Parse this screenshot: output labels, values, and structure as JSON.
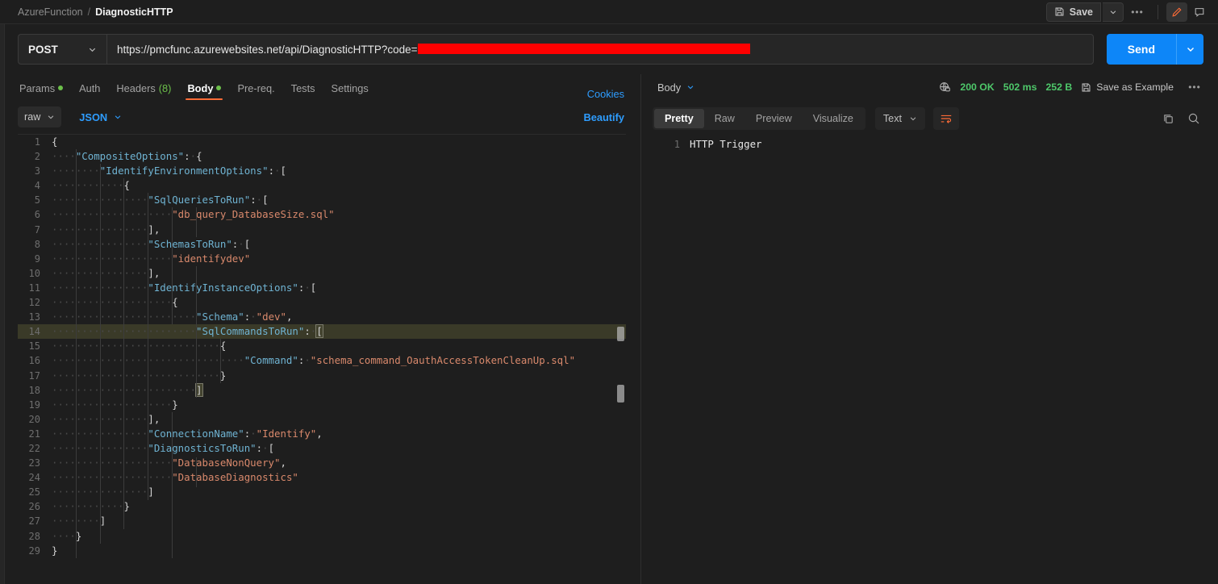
{
  "breadcrumb": {
    "collection": "AzureFunction",
    "separator": "/",
    "request": "DiagnosticHTTP"
  },
  "topbar": {
    "save_label": "Save",
    "save_icon": "floppy-disk-icon",
    "caret_icon": "chevron-down-icon",
    "more_icon": "ellipsis-icon",
    "edit_icon": "pencil-icon",
    "comment_icon": "comment-icon",
    "accent": "#ff6c37"
  },
  "request": {
    "method": "POST",
    "method_caret": "chevron-down-icon",
    "url_visible": "https://pmcfunc.azurewebsites.net/api/DiagnosticHTTP?code=",
    "url_redacted_note": "redacted-secret-bar",
    "redaction_color": "#fe0000",
    "send_label": "Send",
    "send_color": "#0d86f8"
  },
  "request_tabs": [
    {
      "label": "Params",
      "dot": true,
      "active": false
    },
    {
      "label": "Auth",
      "dot": false,
      "active": false
    },
    {
      "label": "Headers",
      "count": "(8)",
      "dot": false,
      "active": false
    },
    {
      "label": "Body",
      "dot": true,
      "active": true
    },
    {
      "label": "Pre-req.",
      "dot": false,
      "active": false
    },
    {
      "label": "Tests",
      "dot": false,
      "active": false
    },
    {
      "label": "Settings",
      "dot": false,
      "active": false
    }
  ],
  "cookies_label": "Cookies",
  "body_options": {
    "mode": "raw",
    "format": "JSON",
    "beautify_label": "Beautify",
    "caret_icon": "chevron-down-icon"
  },
  "request_body": {
    "language": "json",
    "active_line": 14,
    "lines": [
      {
        "n": 1,
        "indent": 0,
        "tokens": [
          {
            "t": "p",
            "v": "{"
          }
        ]
      },
      {
        "n": 2,
        "indent": 1,
        "tokens": [
          {
            "t": "k",
            "v": "\"CompositeOptions\""
          },
          {
            "t": "p",
            "v": ":"
          },
          {
            "t": "ws",
            "v": "·"
          },
          {
            "t": "p",
            "v": "{"
          }
        ]
      },
      {
        "n": 3,
        "indent": 2,
        "tokens": [
          {
            "t": "k",
            "v": "\"IdentifyEnvironmentOptions\""
          },
          {
            "t": "p",
            "v": ":"
          },
          {
            "t": "ws",
            "v": "·"
          },
          {
            "t": "p",
            "v": "["
          }
        ]
      },
      {
        "n": 4,
        "indent": 3,
        "tokens": [
          {
            "t": "p",
            "v": "{"
          }
        ]
      },
      {
        "n": 5,
        "indent": 4,
        "tokens": [
          {
            "t": "k",
            "v": "\"SqlQueriesToRun\""
          },
          {
            "t": "p",
            "v": ":"
          },
          {
            "t": "ws",
            "v": "·"
          },
          {
            "t": "p",
            "v": "["
          }
        ]
      },
      {
        "n": 6,
        "indent": 5,
        "tokens": [
          {
            "t": "s",
            "v": "\"db_query_DatabaseSize.sql\""
          }
        ]
      },
      {
        "n": 7,
        "indent": 4,
        "tokens": [
          {
            "t": "p",
            "v": "],"
          }
        ]
      },
      {
        "n": 8,
        "indent": 4,
        "tokens": [
          {
            "t": "k",
            "v": "\"SchemasToRun\""
          },
          {
            "t": "p",
            "v": ":"
          },
          {
            "t": "ws",
            "v": "·"
          },
          {
            "t": "p",
            "v": "["
          }
        ]
      },
      {
        "n": 9,
        "indent": 5,
        "tokens": [
          {
            "t": "s",
            "v": "\"identifydev\""
          }
        ]
      },
      {
        "n": 10,
        "indent": 4,
        "tokens": [
          {
            "t": "p",
            "v": "],"
          }
        ]
      },
      {
        "n": 11,
        "indent": 4,
        "tokens": [
          {
            "t": "k",
            "v": "\"IdentifyInstanceOptions\""
          },
          {
            "t": "p",
            "v": ":"
          },
          {
            "t": "ws",
            "v": "·"
          },
          {
            "t": "p",
            "v": "["
          }
        ]
      },
      {
        "n": 12,
        "indent": 5,
        "tokens": [
          {
            "t": "p",
            "v": "{"
          }
        ]
      },
      {
        "n": 13,
        "indent": 6,
        "tokens": [
          {
            "t": "k",
            "v": "\"Schema\""
          },
          {
            "t": "p",
            "v": ":"
          },
          {
            "t": "ws",
            "v": "·"
          },
          {
            "t": "s",
            "v": "\"dev\""
          },
          {
            "t": "p",
            "v": ","
          }
        ]
      },
      {
        "n": 14,
        "indent": 6,
        "tokens": [
          {
            "t": "k",
            "v": "\"SqlCommandsToRun\""
          },
          {
            "t": "p",
            "v": ":"
          },
          {
            "t": "ws",
            "v": "·"
          },
          {
            "t": "brk",
            "v": "["
          }
        ]
      },
      {
        "n": 15,
        "indent": 7,
        "tokens": [
          {
            "t": "p",
            "v": "{"
          }
        ]
      },
      {
        "n": 16,
        "indent": 8,
        "tokens": [
          {
            "t": "k",
            "v": "\"Command\""
          },
          {
            "t": "p",
            "v": ":"
          },
          {
            "t": "ws",
            "v": "·"
          },
          {
            "t": "s",
            "v": "\"schema_command_OauthAccessTokenCleanUp.sql\""
          }
        ]
      },
      {
        "n": 17,
        "indent": 7,
        "tokens": [
          {
            "t": "p",
            "v": "}"
          }
        ]
      },
      {
        "n": 18,
        "indent": 6,
        "tokens": [
          {
            "t": "brk",
            "v": "]"
          }
        ]
      },
      {
        "n": 19,
        "indent": 5,
        "tokens": [
          {
            "t": "p",
            "v": "}"
          }
        ]
      },
      {
        "n": 20,
        "indent": 4,
        "tokens": [
          {
            "t": "p",
            "v": "],"
          }
        ]
      },
      {
        "n": 21,
        "indent": 4,
        "tokens": [
          {
            "t": "k",
            "v": "\"ConnectionName\""
          },
          {
            "t": "p",
            "v": ":"
          },
          {
            "t": "ws",
            "v": "·"
          },
          {
            "t": "s",
            "v": "\"Identify\""
          },
          {
            "t": "p",
            "v": ","
          }
        ]
      },
      {
        "n": 22,
        "indent": 4,
        "tokens": [
          {
            "t": "k",
            "v": "\"DiagnosticsToRun\""
          },
          {
            "t": "p",
            "v": ":"
          },
          {
            "t": "ws",
            "v": "·"
          },
          {
            "t": "p",
            "v": "["
          }
        ]
      },
      {
        "n": 23,
        "indent": 5,
        "tokens": [
          {
            "t": "s",
            "v": "\"DatabaseNonQuery\""
          },
          {
            "t": "p",
            "v": ","
          }
        ]
      },
      {
        "n": 24,
        "indent": 5,
        "tokens": [
          {
            "t": "s",
            "v": "\"DatabaseDiagnostics\""
          }
        ]
      },
      {
        "n": 25,
        "indent": 4,
        "tokens": [
          {
            "t": "p",
            "v": "]"
          }
        ]
      },
      {
        "n": 26,
        "indent": 3,
        "tokens": [
          {
            "t": "p",
            "v": "}"
          }
        ]
      },
      {
        "n": 27,
        "indent": 2,
        "tokens": [
          {
            "t": "p",
            "v": "]"
          }
        ]
      },
      {
        "n": 28,
        "indent": 1,
        "tokens": [
          {
            "t": "p",
            "v": "}"
          }
        ]
      },
      {
        "n": 29,
        "indent": 0,
        "tokens": [
          {
            "t": "p",
            "v": "}"
          }
        ]
      }
    ]
  },
  "response": {
    "section_label": "Body",
    "section_caret": "chevron-down-icon",
    "security_icon": "globe-lock-icon",
    "status": "200 OK",
    "time": "502 ms",
    "size": "252 B",
    "save_example_label": "Save as Example",
    "save_example_icon": "floppy-disk-icon",
    "more_icon": "ellipsis-icon",
    "tabs": [
      {
        "label": "Pretty",
        "active": true
      },
      {
        "label": "Raw",
        "active": false
      },
      {
        "label": "Preview",
        "active": false
      },
      {
        "label": "Visualize",
        "active": false
      }
    ],
    "format": "Text",
    "format_caret": "chevron-down-icon",
    "wrap_icon": "word-wrap-icon",
    "copy_icon": "copy-icon",
    "search_icon": "search-icon",
    "body_lines": [
      {
        "n": 1,
        "text": "HTTP Trigger"
      }
    ]
  }
}
